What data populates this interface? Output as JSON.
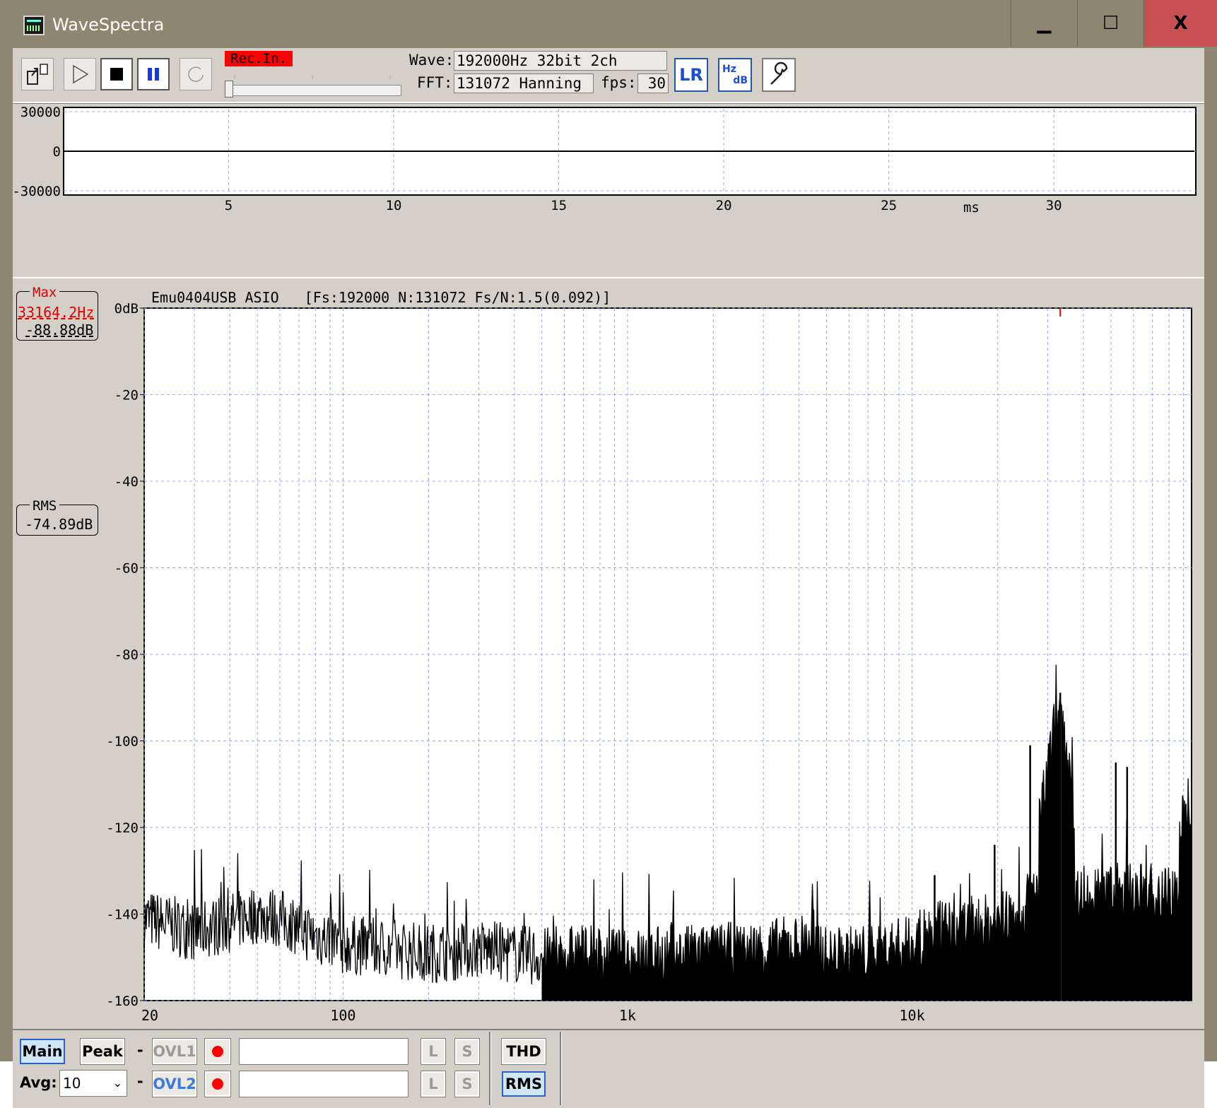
{
  "window": {
    "title": "WaveSpectra",
    "minimize_glyph": "▁",
    "maximize_glyph": "☐",
    "close_glyph": "X"
  },
  "toolbar": {
    "rec_label": "Rec.In.",
    "wave_label": "Wave:",
    "wave_value": "192000Hz 32bit 2ch",
    "fft_label": "FFT:",
    "fft_value": "131072 Hanning",
    "fps_label": "fps:",
    "fps_value": "30",
    "lr_label": "LR",
    "hzdb_label_top": "Hz",
    "hzdb_label_bottom": "dB",
    "icons": [
      "export-icon",
      "play-icon",
      "stop-icon",
      "pause-icon",
      "reload-icon",
      "lr-icon",
      "hz-db-icon",
      "settings-wrench-icon"
    ]
  },
  "wave": {
    "y_ticks": [
      "30000",
      "0",
      "-30000"
    ],
    "x_ticks": [
      "5",
      "10",
      "15",
      "20",
      "25",
      "30"
    ],
    "x_unit": "ms",
    "line_color": "#000000",
    "grid_color": "#9ea6e8"
  },
  "spectrum": {
    "header": "Emu0404USB ASIO   [Fs:192000 N:131072 Fs/N:1.5(0.092)]",
    "max_label": "Max",
    "max_freq": "33164.2Hz",
    "max_db": "-88.88dB",
    "rms_label": "RMS",
    "rms_db": "-74.89dB",
    "y_ticks": [
      "0dB",
      "-20",
      "-40",
      "-60",
      "-80",
      "-100",
      "-120",
      "-140",
      "-160"
    ],
    "x_ticks": [
      "20",
      "100",
      "1k",
      "10k"
    ],
    "accent_color": "#ff0000"
  },
  "chart_data": {
    "type": "line",
    "xscale": "log",
    "xlim": [
      20,
      96000
    ],
    "ylim": [
      -160,
      0
    ],
    "series": [
      {
        "x": [
          20,
          30,
          40,
          50,
          60,
          80,
          100,
          150,
          200,
          300,
          500,
          700,
          1000,
          2000,
          3000,
          4000,
          4500,
          5000,
          7000,
          10000,
          12000,
          15000,
          20000,
          25000,
          33164,
          40000,
          50000,
          60000,
          70000,
          90000
        ],
        "y": [
          -141,
          -144,
          -142,
          -140,
          -141,
          -145,
          -147,
          -148,
          -149,
          -148,
          -150,
          -149,
          -150,
          -149,
          -148,
          -147,
          -145,
          -150,
          -149,
          -147,
          -144,
          -143,
          -142,
          -140,
          -89,
          -138,
          -134,
          -130,
          -126,
          -119
        ]
      }
    ],
    "peaks": [
      {
        "x": 33164,
        "y": -88.88
      },
      {
        "x": 26000,
        "y": -101
      },
      {
        "x": 52000,
        "y": -105
      },
      {
        "x": 57000,
        "y": -106
      },
      {
        "x": 19500,
        "y": -124
      },
      {
        "x": 12000,
        "y": -131
      }
    ]
  },
  "bottom": {
    "main_label": "Main",
    "peak_label": "Peak",
    "dash": "-",
    "ovl1_label": "OVL1",
    "ovl2_label": "OVL2",
    "l_label": "L",
    "s_label": "S",
    "avg_label": "Avg:",
    "avg_value": "10",
    "thd_label": "THD",
    "rms_label": "RMS"
  }
}
